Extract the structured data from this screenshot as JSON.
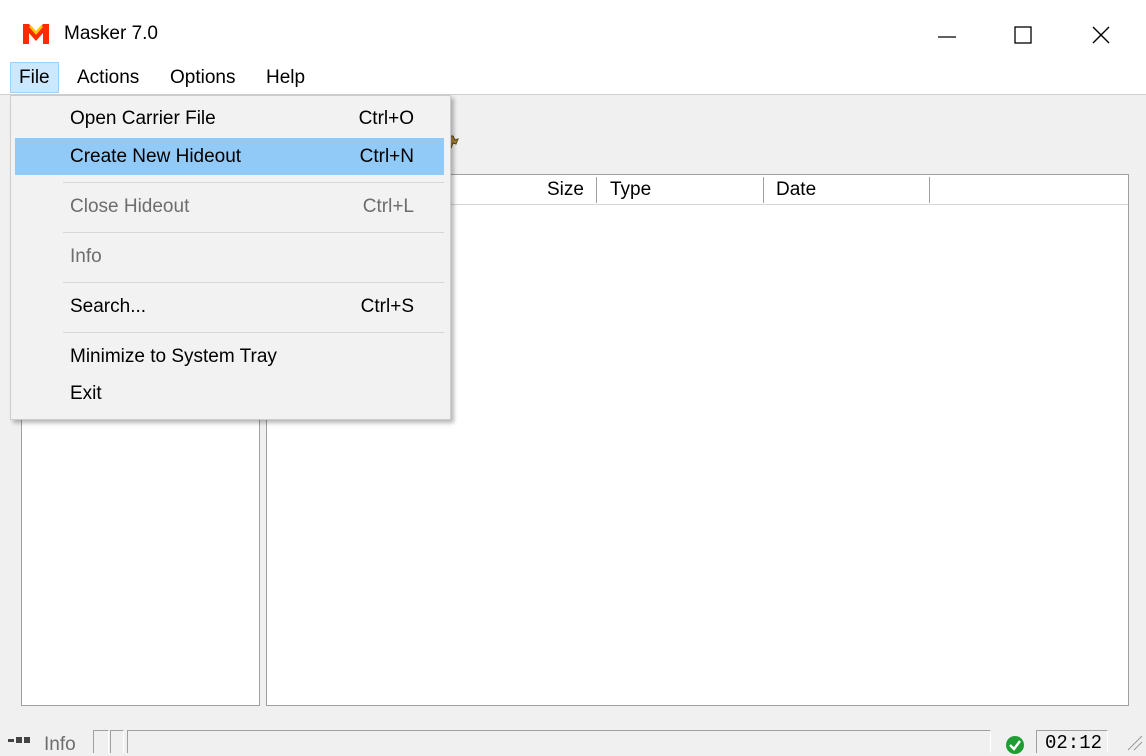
{
  "window": {
    "title": "Masker 7.0",
    "icon": "masker-m-logo",
    "controls": [
      "minimize-icon",
      "maximize-icon",
      "close-icon"
    ]
  },
  "menubar": {
    "items": [
      {
        "label": "File",
        "active": true
      },
      {
        "label": "Actions"
      },
      {
        "label": "Options"
      },
      {
        "label": "Help"
      }
    ]
  },
  "file_menu": {
    "items": [
      {
        "label": "Open Carrier File",
        "shortcut": "Ctrl+O",
        "enabled": true
      },
      {
        "label": "Create New Hideout",
        "shortcut": "Ctrl+N",
        "enabled": true,
        "highlighted": true
      },
      {
        "label": "Close Hideout",
        "shortcut": "Ctrl+L",
        "enabled": false
      },
      {
        "label": "Info",
        "shortcut": "",
        "enabled": false
      },
      {
        "label": "Search...",
        "shortcut": "Ctrl+S",
        "enabled": true
      },
      {
        "label": "Minimize to System Tray",
        "shortcut": "",
        "enabled": true
      },
      {
        "label": "Exit",
        "shortcut": "",
        "enabled": true
      }
    ]
  },
  "file_list": {
    "columns": [
      "Size",
      "Type",
      "Date",
      ""
    ]
  },
  "statusbar": {
    "info_label": "Info",
    "time": "02:12",
    "status_icon": "check-icon"
  },
  "colors": {
    "menu_highlight": "#91c9f7",
    "active_menu": "#cce8ff",
    "logo_red": "#ff2a00",
    "logo_yellow": "#ffc800",
    "ok_green": "#1f9d32"
  }
}
